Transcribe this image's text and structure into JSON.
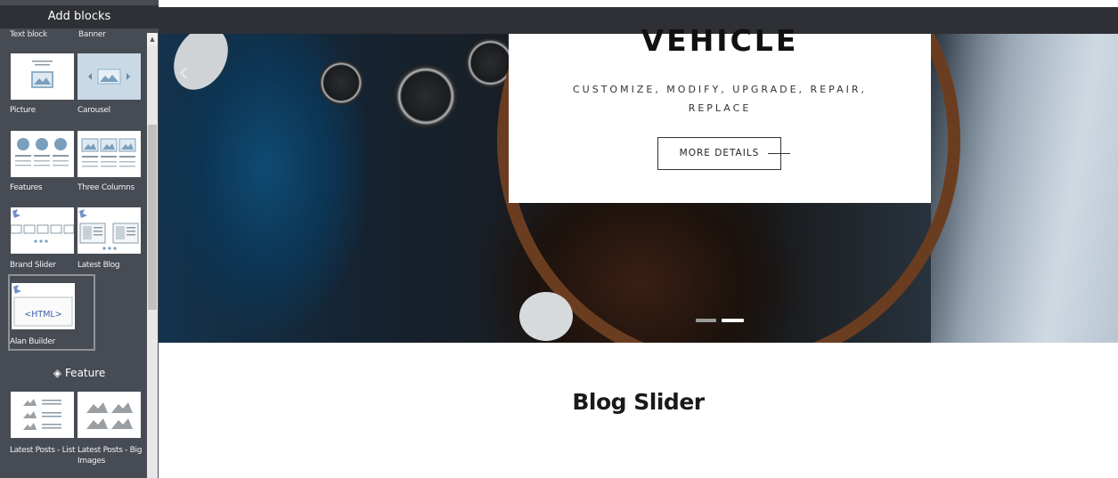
{
  "sidebar": {
    "title": "Add blocks",
    "cut_labels": [
      "Text block",
      "Banner"
    ],
    "blocks": [
      {
        "label": "Picture"
      },
      {
        "label": "Carousel"
      },
      {
        "label": "Features"
      },
      {
        "label": "Three Columns"
      },
      {
        "label": "Brand Slider"
      },
      {
        "label": "Latest Blog"
      },
      {
        "label": "Alan Builder",
        "html_tag": "<HTML>"
      },
      {
        "label": "Latest Posts - List"
      },
      {
        "label": "Latest Posts - Big Images"
      }
    ],
    "feature_heading": "Feature"
  },
  "hero": {
    "title": "VEHICLE",
    "subtitle": "CUSTOMIZE, MODIFY, UPGRADE, REPAIR, REPLACE",
    "button_label": "MORE DETAILS",
    "arrow_glyph": "‹"
  },
  "main": {
    "section_title": "Blog Slider"
  },
  "colors": {
    "sidebar_bg": "#474b53",
    "header_bg": "#2e3036",
    "selection_border": "#8f9398",
    "accent_blue": "#7090c8"
  },
  "icons": [
    "diamond-icon",
    "image-icon",
    "chevron-left-icon",
    "chevron-right-icon",
    "brush-icon",
    "scroll-up-icon"
  ]
}
